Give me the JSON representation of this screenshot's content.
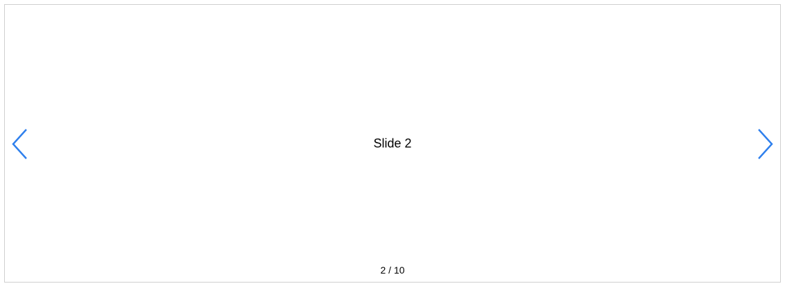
{
  "carousel": {
    "current_slide_label": "Slide 2",
    "pagination": {
      "current": "2",
      "separator": "/",
      "total": "10"
    },
    "nav": {
      "prev_icon": "chevron-left-icon",
      "next_icon": "chevron-right-icon"
    },
    "colors": {
      "accent": "#2f80ed",
      "border": "#cfcfcf",
      "text": "#000000"
    }
  }
}
